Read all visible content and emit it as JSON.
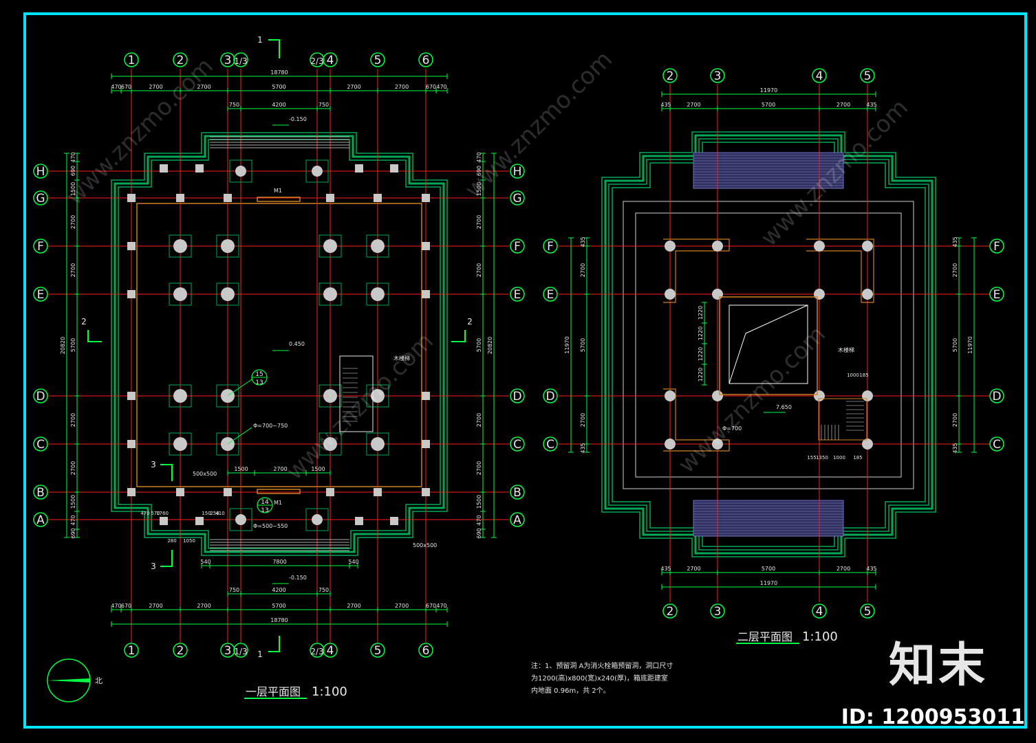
{
  "colors": {
    "frame": "#00e5ff",
    "grid_line": "#ff2020",
    "dimension": "#00ff40",
    "wall": "#00aa55",
    "column": "#c8c8c8",
    "text": "#e8e8e8",
    "stair": "#d08020"
  },
  "plan1": {
    "title": "一层平面图",
    "scale": "1:100",
    "axes_top": [
      "1",
      "2",
      "3",
      "1/3",
      "2/3",
      "4",
      "5",
      "6"
    ],
    "axes_side": [
      "H",
      "G",
      "F",
      "E",
      "D",
      "C",
      "B",
      "A"
    ],
    "overall_width": "18780",
    "bays": [
      "470",
      "670",
      "2700",
      "2700",
      "5700",
      "2700",
      "2700",
      "670",
      "470"
    ],
    "entry_dims": [
      "750",
      "4200",
      "750"
    ],
    "level_top": "-0.150",
    "level_center": "0.450",
    "level_bottom": "-0.150",
    "door_label": "M1",
    "side_dims": [
      "470",
      "690",
      "1500",
      "2700",
      "2700",
      "5700",
      "2700",
      "2700",
      "1500",
      "470",
      "690"
    ],
    "side_total": "20820",
    "section_mark_1": "1",
    "section_mark_2": "2",
    "section_mark_3": "3",
    "detail_15": "15",
    "detail_13": "13",
    "detail_14": "14",
    "col_note_1": "Φ=700~750",
    "col_note_2": "Φ=500~550",
    "col_size_1": "500x500",
    "col_size_2": "500x500",
    "stair_note": "木楼梯",
    "bottom_dims": [
      "1500",
      "2700",
      "1500"
    ],
    "front_dims": [
      "540",
      "7800",
      "540"
    ],
    "lower_dims": [
      "470",
      "570",
      "1760",
      "150",
      "250",
      "410",
      "280",
      "1050"
    ],
    "north_label": "北"
  },
  "plan2": {
    "title": "二层平面图",
    "scale": "1:100",
    "axes_top": [
      "2",
      "3",
      "4",
      "5"
    ],
    "axes_side": [
      "F",
      "E",
      "D",
      "C"
    ],
    "overall_width": "11970",
    "bays": [
      "435",
      "2700",
      "5700",
      "2700",
      "435"
    ],
    "side_dims": [
      "435",
      "2700",
      "5700",
      "2700",
      "435"
    ],
    "side_total": "11970",
    "opening_dims": [
      "1220",
      "1220",
      "1220",
      "1220"
    ],
    "level": "7.650",
    "col_note": "Φ=700",
    "stair_note": "木楼梯",
    "stair_dims": [
      "1000",
      "185",
      "1350",
      "1000",
      "185",
      "155"
    ]
  },
  "notes": {
    "line1": "注：1、预留洞  A为消火栓箱预留洞，洞口尺寸",
    "line2": "为1200(高)x800(宽)x240(厚)，箱底距建室",
    "line3": "内地面 0.96m，共 2个。"
  },
  "watermark": {
    "logo": "知末",
    "id": "ID: 1200953011",
    "site": "www.znzmo.com"
  }
}
